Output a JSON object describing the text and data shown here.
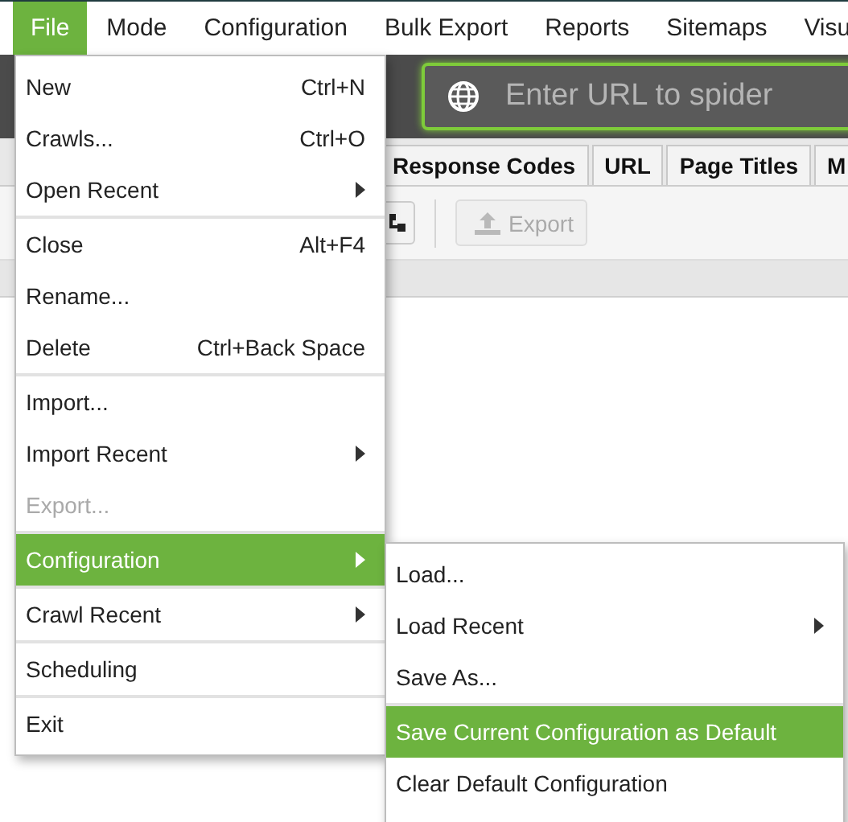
{
  "menubar": [
    {
      "label": "File",
      "selected": true
    },
    {
      "label": "Mode",
      "selected": false
    },
    {
      "label": "Configuration",
      "selected": false
    },
    {
      "label": "Bulk Export",
      "selected": false
    },
    {
      "label": "Reports",
      "selected": false
    },
    {
      "label": "Sitemaps",
      "selected": false
    },
    {
      "label": "Visu",
      "selected": false
    }
  ],
  "url_field": {
    "placeholder": "Enter URL to spider"
  },
  "tabs": [
    {
      "label": "Response Codes",
      "selected": false
    },
    {
      "label": "URL",
      "selected": false
    },
    {
      "label": "Page Titles",
      "selected": false
    },
    {
      "label": "M",
      "selected": false
    }
  ],
  "toolbar": {
    "export_button": {
      "label": "Export",
      "disabled": true
    }
  },
  "file_menu": {
    "groups": [
      [
        {
          "label": "New",
          "shortcut": "Ctrl+N",
          "submenu": false,
          "disabled": false,
          "selected": false
        },
        {
          "label": "Crawls...",
          "shortcut": "Ctrl+O",
          "submenu": false,
          "disabled": false,
          "selected": false
        },
        {
          "label": "Open Recent",
          "submenu": true,
          "disabled": false,
          "selected": false
        }
      ],
      [
        {
          "label": "Close",
          "shortcut": "Alt+F4",
          "submenu": false,
          "disabled": false,
          "selected": false
        },
        {
          "label": "Rename...",
          "submenu": false,
          "disabled": false,
          "selected": false
        },
        {
          "label": "Delete",
          "shortcut": "Ctrl+Back Space",
          "submenu": false,
          "disabled": false,
          "selected": false
        }
      ],
      [
        {
          "label": "Import...",
          "submenu": false,
          "disabled": false,
          "selected": false
        },
        {
          "label": "Import Recent",
          "submenu": true,
          "disabled": false,
          "selected": false
        },
        {
          "label": "Export...",
          "submenu": false,
          "disabled": true,
          "selected": false
        }
      ],
      [
        {
          "label": "Configuration",
          "submenu": true,
          "disabled": false,
          "selected": true
        }
      ],
      [
        {
          "label": "Crawl Recent",
          "submenu": true,
          "disabled": false,
          "selected": false
        }
      ],
      [
        {
          "label": "Scheduling",
          "submenu": false,
          "disabled": false,
          "selected": false
        }
      ],
      [
        {
          "label": "Exit",
          "submenu": false,
          "disabled": false,
          "selected": false
        }
      ]
    ]
  },
  "configuration_submenu": {
    "groups": [
      [
        {
          "label": "Load...",
          "submenu": false,
          "disabled": false,
          "selected": false
        },
        {
          "label": "Load Recent",
          "submenu": true,
          "disabled": false,
          "selected": false
        },
        {
          "label": "Save As...",
          "submenu": false,
          "disabled": false,
          "selected": false
        }
      ],
      [
        {
          "label": "Save Current Configuration as Default",
          "submenu": false,
          "disabled": false,
          "selected": true
        },
        {
          "label": "Clear Default Configuration",
          "submenu": false,
          "disabled": false,
          "selected": false
        }
      ]
    ]
  }
}
